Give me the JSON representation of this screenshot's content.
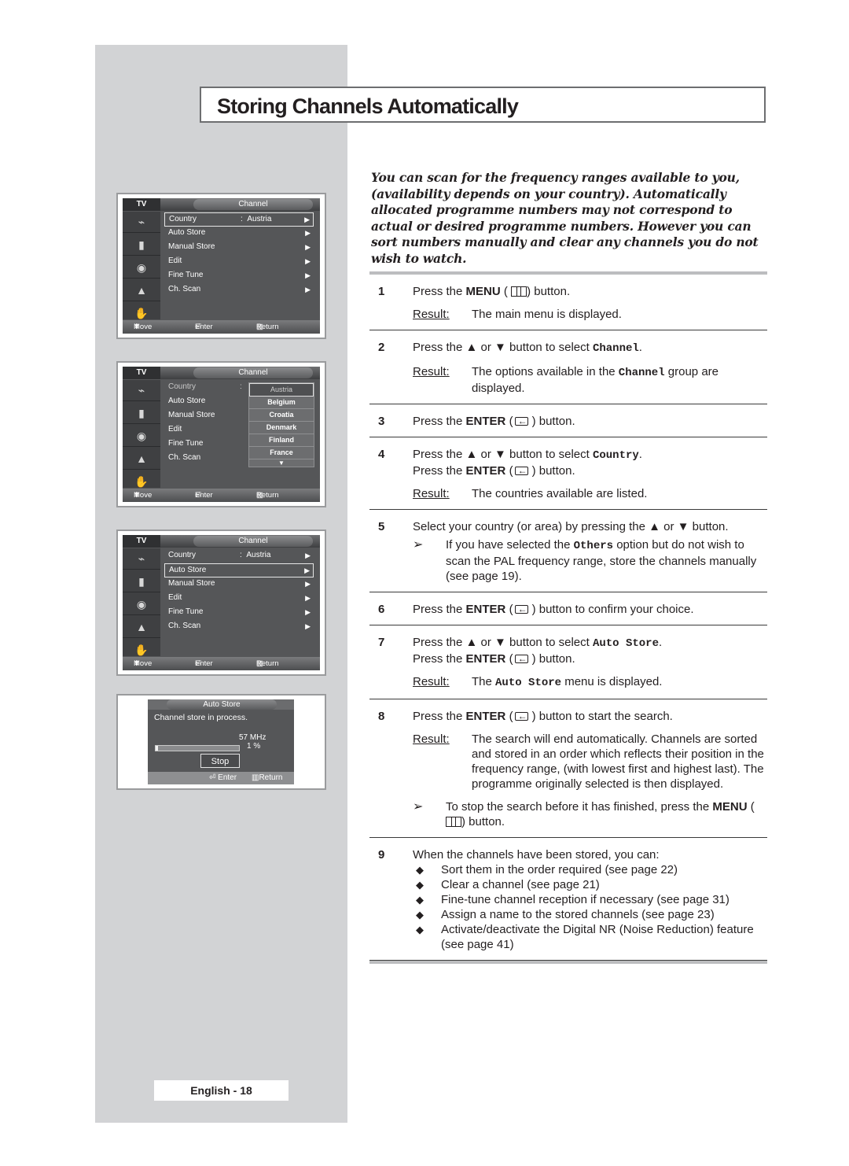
{
  "page": {
    "title": "Storing Channels Automatically",
    "footer": "English - 18",
    "intro": "You can scan for the frequency ranges available to you, (availability depends on your country). Automatically allocated programme numbers may not correspond to actual or desired programme numbers. However you can sort numbers manually and clear any channels you do not wish to watch."
  },
  "osd_common": {
    "tv_label": "TV",
    "menu_title": "Channel",
    "footer_move": "Move",
    "footer_enter": "Enter",
    "footer_return": "Return",
    "icons": [
      "antenna-icon",
      "picture-icon",
      "sound-icon",
      "setup-icon",
      "function-icon"
    ],
    "items": [
      "Country",
      "Auto Store",
      "Manual Store",
      "Edit",
      "Fine Tune",
      "Ch. Scan"
    ],
    "country_separator": ":",
    "country_value": "Austria",
    "arrow": "▶"
  },
  "osd_screens": [
    {
      "selected": "Country"
    },
    {
      "selected": "Country",
      "dropdown_open": true
    },
    {
      "selected": "Auto Store"
    }
  ],
  "country_dropdown": {
    "options": [
      "Austria",
      "Belgium",
      "Croatia",
      "Denmark",
      "Finland",
      "France"
    ],
    "selected": "Austria",
    "more": "▼"
  },
  "auto_store": {
    "title": "Auto Store",
    "message": "Channel store in process.",
    "frequency": "57 MHz",
    "progress_percent": 1,
    "progress_label": "1 %",
    "stop_label": "Stop",
    "footer_enter": "Enter",
    "footer_return": "Return"
  },
  "steps": [
    {
      "num": "1",
      "lines": [
        "Press the",
        "MENU",
        "button."
      ],
      "result": "The main menu is displayed."
    },
    {
      "num": "2",
      "text_a": "Press the ▲ or ▼ button to select",
      "code": "Channel",
      "result_a": "The options available in the",
      "result_code": "Channel",
      "result_b": "group are displayed."
    },
    {
      "num": "3",
      "text_a": "Press the",
      "bold": "ENTER",
      "text_b": "button."
    },
    {
      "num": "4",
      "text_a": "Press the ▲ or ▼ button to select",
      "code": "Country",
      "text_c": "Press the",
      "bold": "ENTER",
      "text_d": "button.",
      "result": "The countries available are listed."
    },
    {
      "num": "5",
      "text": "Select your country (or area) by pressing the ▲ or ▼ button.",
      "note_a": "If you have selected the",
      "note_code": "Others",
      "note_b": "option but do not wish to scan the PAL frequency range, store the channels manually (see page 19)."
    },
    {
      "num": "6",
      "text_a": "Press the",
      "bold": "ENTER",
      "text_b": "button to confirm your choice."
    },
    {
      "num": "7",
      "text_a": "Press the ▲ or ▼ button to select",
      "code": "Auto Store",
      "text_c": "Press the",
      "bold": "ENTER",
      "text_d": "button.",
      "result_a": "The",
      "result_code": "Auto Store",
      "result_b": "menu is displayed."
    },
    {
      "num": "8",
      "text_a": "Press the",
      "bold": "ENTER",
      "text_b": "button to start the search.",
      "result": "The search will end automatically. Channels are sorted and stored in an order which reflects their position in the frequency range, (with lowest first and highest last). The programme originally selected is then displayed.",
      "note_a": "To stop the search before it has finished, press the",
      "note_bold": "MENU",
      "note_b": "button."
    },
    {
      "num": "9",
      "text": "When the channels have been stored, you can:",
      "bullets": [
        "Sort them in the order required (see page 22)",
        "Clear a channel (see page 21)",
        "Fine-tune channel reception if necessary (see page 31)",
        "Assign a name to the stored channels (see page 23)",
        "Activate/deactivate the Digital NR (Noise Reduction) feature (see page 41)"
      ]
    }
  ],
  "labels": {
    "result": "Result",
    "result_colon": ":",
    "note_mark": "➢",
    "bullet_mark": "◆",
    "open_paren": "(",
    "close_paren": ")"
  }
}
